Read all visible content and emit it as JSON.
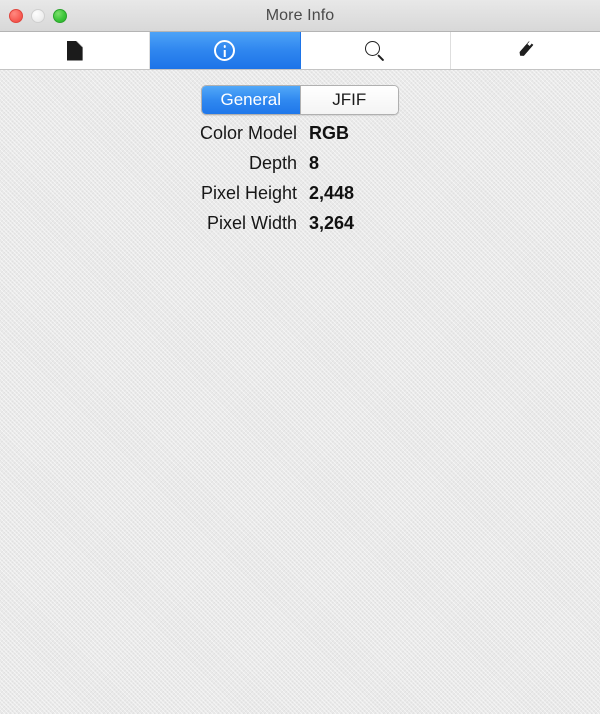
{
  "window": {
    "title": "More Info",
    "traffic_lights": [
      {
        "name": "close",
        "color": "#f96058",
        "enabled": true
      },
      {
        "name": "minimize",
        "color": "#e2e2e2",
        "enabled": false
      },
      {
        "name": "zoom",
        "color": "#3cc63a",
        "enabled": true
      }
    ]
  },
  "toolbar": {
    "items": [
      {
        "icon": "document-icon",
        "label": "",
        "selected": false
      },
      {
        "icon": "info-icon",
        "label": "",
        "selected": true
      },
      {
        "icon": "search-icon",
        "label": "",
        "selected": false
      },
      {
        "icon": "pencil-icon",
        "label": "",
        "selected": false
      }
    ],
    "selected_color": "#2f86ef"
  },
  "segmented_control": {
    "segments": [
      {
        "label": "General",
        "selected": true
      },
      {
        "label": "JFIF",
        "selected": false
      }
    ],
    "active_color": "#2f88f0"
  },
  "info": {
    "rows": [
      {
        "label": "Color Model",
        "value": "RGB"
      },
      {
        "label": "Depth",
        "value": "8"
      },
      {
        "label": "Pixel Height",
        "value": "2,448"
      },
      {
        "label": "Pixel Width",
        "value": "3,264"
      }
    ]
  }
}
